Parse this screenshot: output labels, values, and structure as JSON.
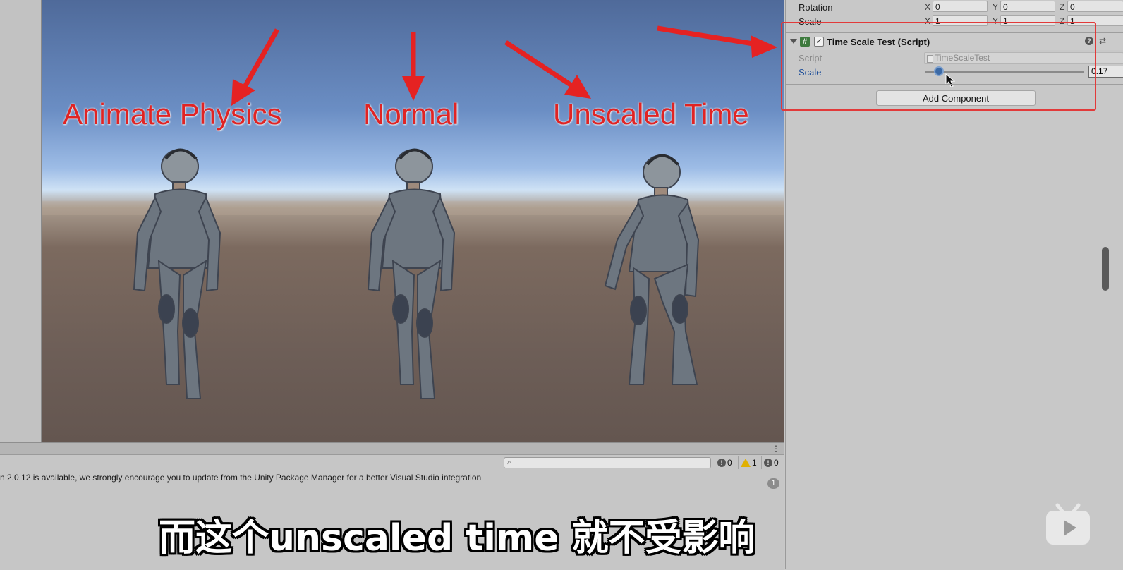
{
  "scene": {
    "labels": [
      "Animate Physics",
      "Normal",
      "Unscaled Time"
    ]
  },
  "inspector": {
    "transform": {
      "rotation": {
        "label": "Rotation",
        "x": "0",
        "y": "0",
        "z": "0"
      },
      "scale": {
        "label": "Scale",
        "x": "1",
        "y": "1",
        "z": "1"
      },
      "axis_labels": [
        "X",
        "Y",
        "Z"
      ]
    },
    "component": {
      "title": "Time Scale Test (Script)",
      "enabled": true,
      "script_label": "Script",
      "script_value": "TimeScaleTest",
      "scale_label": "Scale",
      "scale_value": "0.17",
      "scale_fraction": 0.17
    },
    "add_component_label": "Add Component"
  },
  "console": {
    "search_placeholder": "",
    "error_count": "0",
    "warning_count": "1",
    "info_count": "0",
    "message": "n 2.0.12 is available, we strongly encourage you to update from the Unity Package Manager for a better Visual Studio integration",
    "message_count": "1"
  },
  "subtitle": "而这个unscaled time 就不受影响",
  "colors": {
    "annotation_red": "#e02424",
    "accent_blue": "#3c6aa6"
  }
}
